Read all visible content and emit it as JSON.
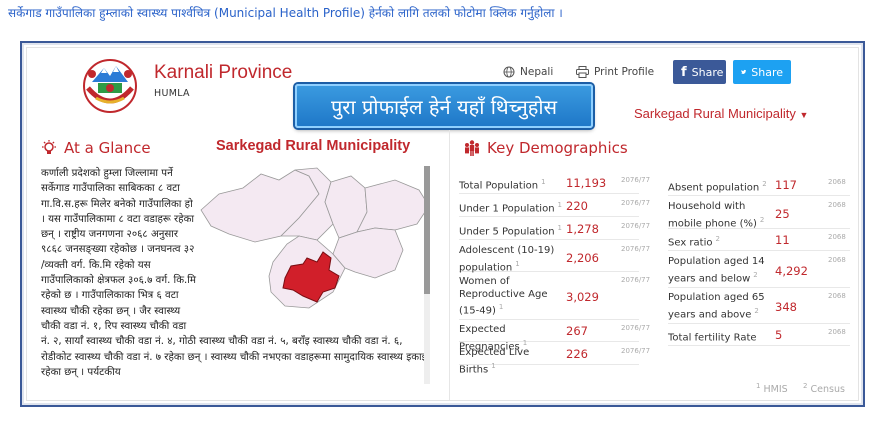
{
  "intro_text": "सर्केगाड गाउँपालिका हुम्लाको स्वास्थ्य पार्श्वचित्र (Municipal Health Profile) हेर्नको लागि तलको फोटोमा क्लिक गर्नुहोला ।",
  "header": {
    "province": "Karnali Province",
    "district": "HUMLA",
    "language_link": "Nepali",
    "print_link": "Print Profile",
    "share_facebook": "Share",
    "share_twitter": "Share",
    "banner": "पुरा प्रोफाईल हेर्न यहाँ थिच्नुहोस",
    "municipality_select": "Sarkegad Rural Municipality"
  },
  "glance": {
    "title": "At a Glance",
    "municipality": "Sarkegad Rural Municipality",
    "text": "कर्णाली प्रदेशको हुम्ला जिल्लामा पर्ने सर्केगाड गाउँपालिका साबिकका ८ वटा गा.वि.स.हरू मिलेर बनेको गाउँपालिका हो । यस गाउँपालिकामा ८ वटा वडाहरू रहेका छन् । राष्ट्रीय जनगणना २०६८ अनुसार ९८६८ जनसङ्ख्या रहेकोछ । जनघनत्व ३२ /व्यक्ती वर्ग. कि.मि रहेको यस गाउँपालिकाको क्षेत्रफल ३०६.७ वर्ग. कि.मि रहेको छ । गाउँपालिकाका भित्र ६ वटा स्वास्थ्य चौकी रहेका छन् । जैर स्वास्थ्य चौकी वडा नं. १, रिप स्वास्थ्य चौकी वडा नं. २, सार्याँ स्वास्थ्य चौकी वडा नं. ४, गोठी स्वास्थ्य चौकी वडा नं. ५, बराँइ स्वास्थ्य चौकी वडा नं. ६, रोडीकोट स्वास्थ्य चौकी वडा नं. ७ रहेका छन् । स्वास्थ्य चौकी नभएका वडाहरूमा सामुदायिक स्वास्थ्य इकाइ रहेका छन् । पर्यटकीय"
  },
  "demographics": {
    "title": "Key Demographics",
    "left": [
      {
        "label": "Total Population",
        "src": "1",
        "value": "11,193",
        "year": "2076/77"
      },
      {
        "label": "Under 1 Population",
        "src": "1",
        "value": "220",
        "year": "2076/77"
      },
      {
        "label": "Under 5 Population",
        "src": "1",
        "value": "1,278",
        "year": "2076/77"
      },
      {
        "label": "Adolescent (10-19) population",
        "src": "1",
        "value": "2,206",
        "year": "2076/77"
      },
      {
        "label": "Women of Reproductive Age (15-49)",
        "src": "1",
        "value": "3,029",
        "year": "2076/77"
      },
      {
        "label": "Expected Pregnancies",
        "src": "1",
        "value": "267",
        "year": "2076/77"
      },
      {
        "label": "Expected Live Births",
        "src": "1",
        "value": "226",
        "year": "2076/77"
      }
    ],
    "right": [
      {
        "label": "Absent population",
        "src": "2",
        "value": "117",
        "year": "2068"
      },
      {
        "label": "Household with mobile phone (%)",
        "src": "2",
        "value": "25",
        "year": "2068"
      },
      {
        "label": "Sex ratio",
        "src": "2",
        "value": "11",
        "year": "2068"
      },
      {
        "label": "Population aged 14 years and below",
        "src": "2",
        "value": "4,292",
        "year": "2068"
      },
      {
        "label": "Population aged 65 years and above",
        "src": "2",
        "value": "348",
        "year": "2068"
      },
      {
        "label": "Total fertility Rate",
        "src": "",
        "value": "5",
        "year": "2068"
      }
    ],
    "legend_hmis": "HMIS",
    "legend_hmis_num": "1",
    "legend_census": "Census",
    "legend_census_num": "2"
  },
  "colors": {
    "accent": "#c0282d",
    "facebook": "#3b5998",
    "twitter": "#1da1f2",
    "banner": "#2a86d6",
    "selected_region": "#d11f2a"
  }
}
